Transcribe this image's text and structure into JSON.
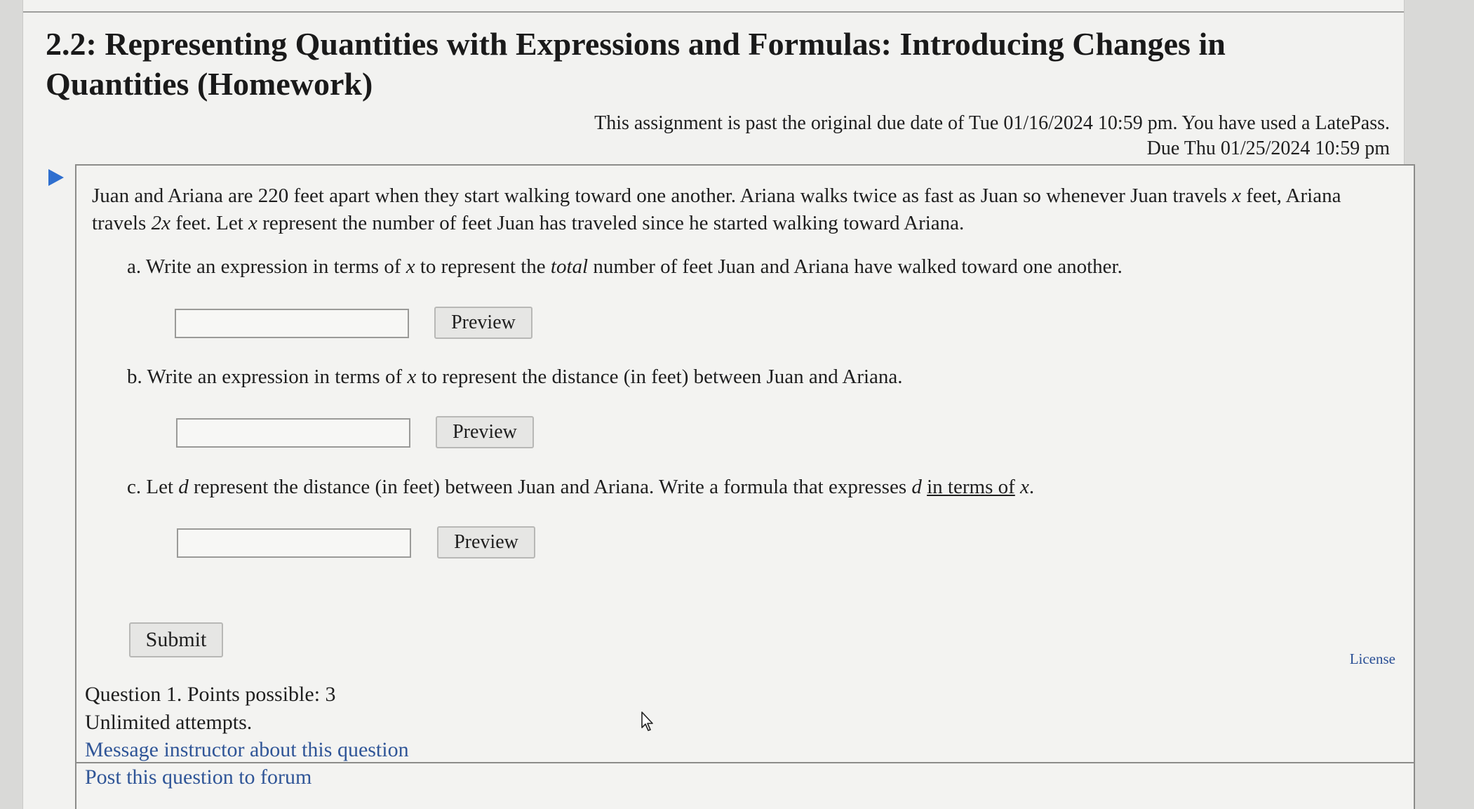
{
  "page": {
    "title": "2.2: Representing Quantities with Expressions and Formulas: Introducing Changes in Quantities (Homework)",
    "late_notice": "This assignment is past the original due date of Tue 01/16/2024 10:59 pm. You have used a LatePass.",
    "due_date": "Due Thu 01/25/2024 10:59 pm"
  },
  "question": {
    "intro": {
      "t1": "Juan and Ariana are 220 feet apart when they start walking toward one another. Ariana walks twice as fast as Juan so whenever Juan travels ",
      "x1": "x",
      "t2": " feet, Ariana travels ",
      "x2": "2x",
      "t3": " feet. Let ",
      "x3": "x",
      "t4": " represent the number of feet Juan has traveled since he started walking toward Ariana."
    },
    "part_a": {
      "t1": "a. Write an expression in terms of ",
      "x1": "x",
      "t2": " to represent the ",
      "em": "total",
      "t3": " number of feet Juan and Ariana have walked toward one another.",
      "input_value": "",
      "preview_label": "Preview"
    },
    "part_b": {
      "t1": "b. Write an expression in terms of ",
      "x1": "x",
      "t2": " to represent the distance (in feet) between Juan and Ariana.",
      "input_value": "",
      "preview_label": "Preview"
    },
    "part_c": {
      "t1": "c. Let ",
      "d1": "d",
      "t2": " represent the distance (in feet) between Juan and Ariana. Write a formula that expresses ",
      "d2": "d",
      "link": "in terms of",
      "x1": "x",
      "t3": ".",
      "input_value": "",
      "preview_label": "Preview"
    },
    "submit_label": "Submit",
    "license_label": "License"
  },
  "info": {
    "points": "Question 1. Points possible: 3",
    "attempts": "Unlimited attempts.",
    "message_link": "Message instructor about this question",
    "forum_link": "Post this question to forum"
  },
  "colors": {
    "link": "#2f5597",
    "arrow": "#2f6fcf",
    "background": "#f2f2f0"
  },
  "icons": {
    "expand": "triangle-right-icon",
    "cursor": "mouse-pointer-icon"
  }
}
